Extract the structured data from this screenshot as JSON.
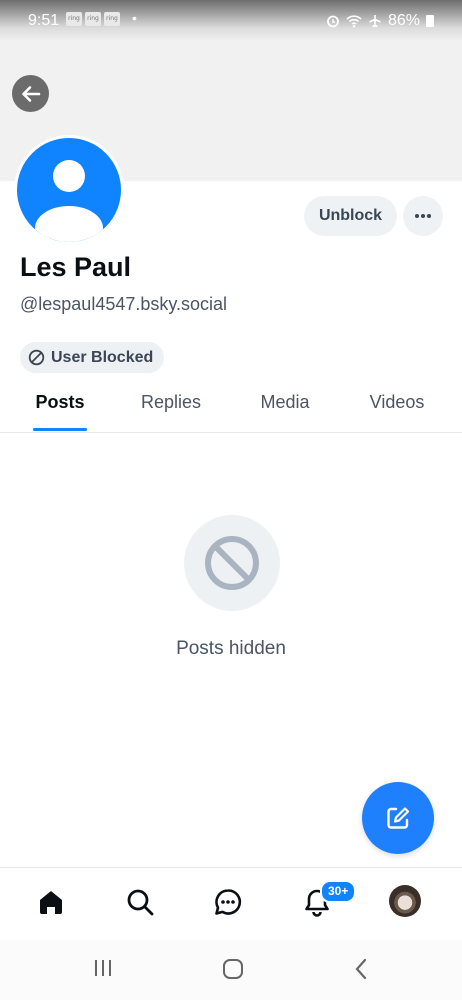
{
  "status_bar": {
    "time": "9:51",
    "notification_icons": [
      "ring",
      "ring",
      "ring"
    ],
    "battery_text": "86%"
  },
  "profile": {
    "display_name": "Les Paul",
    "handle": "@lespaul4547.bsky.social",
    "unblock_label": "Unblock",
    "blocked_badge": "User Blocked"
  },
  "tabs": [
    {
      "label": "Posts",
      "active": true
    },
    {
      "label": "Replies",
      "active": false
    },
    {
      "label": "Media",
      "active": false
    },
    {
      "label": "Videos",
      "active": false
    }
  ],
  "empty_state": {
    "icon": "ban-icon",
    "text": "Posts hidden"
  },
  "bottom_nav": {
    "items": [
      "home-icon",
      "search-icon",
      "chat-icon",
      "bell-icon",
      "profile-avatar"
    ],
    "notification_count": "30+"
  },
  "colors": {
    "accent": "#1083fe",
    "compose": "#1f80fe",
    "text_primary": "#0b0f14",
    "text_secondary": "#4b5563",
    "chip_bg": "#eff2f5"
  }
}
